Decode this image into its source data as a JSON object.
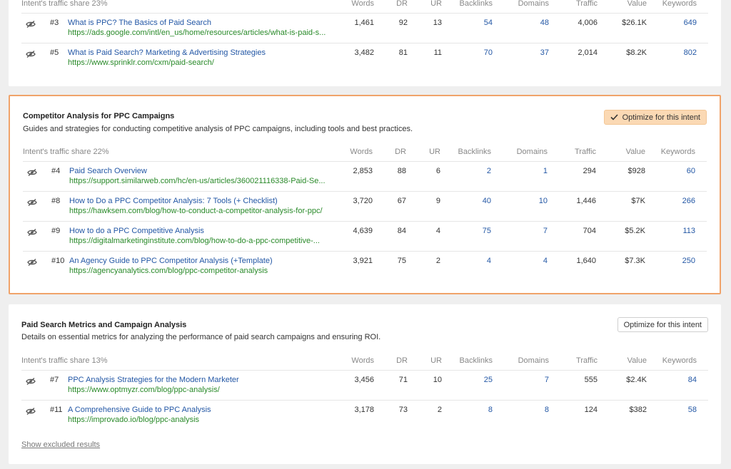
{
  "clusters": [
    {
      "traffic_share": "Intent's traffic share 23%",
      "rows": [
        {
          "rank": "#3",
          "title": "What is PPC? The Basics of Paid Search",
          "url": "https://ads.google.com/intl/en_us/home/resources/articles/what-is-paid-s...",
          "words": "1,461",
          "dr": "92",
          "ur": "13",
          "backlinks": "54",
          "domains": "48",
          "traffic": "4,006",
          "value": "$26.1K",
          "keywords": "649"
        },
        {
          "rank": "#5",
          "title": "What is Paid Search? Marketing & Advertising Strategies",
          "url": "https://www.sprinklr.com/cxm/paid-search/",
          "words": "3,482",
          "dr": "81",
          "ur": "11",
          "backlinks": "70",
          "domains": "37",
          "traffic": "2,014",
          "value": "$8.2K",
          "keywords": "802"
        }
      ]
    },
    {
      "title": "Competitor Analysis for PPC Campaigns",
      "description": "Guides and strategies for conducting competitive analysis of PPC campaigns, including tools and best practices.",
      "button_label": "Optimize for this intent",
      "traffic_share": "Intent's traffic share 22%",
      "rows": [
        {
          "rank": "#4",
          "title": "Paid Search Overview",
          "url": "https://support.similarweb.com/hc/en-us/articles/360021116338-Paid-Se...",
          "words": "2,853",
          "dr": "88",
          "ur": "6",
          "backlinks": "2",
          "domains": "1",
          "traffic": "294",
          "value": "$928",
          "keywords": "60"
        },
        {
          "rank": "#8",
          "title": "How to Do a PPC Competitor Analysis: 7 Tools (+ Checklist)",
          "url": "https://hawksem.com/blog/how-to-conduct-a-competitor-analysis-for-ppc/",
          "words": "3,720",
          "dr": "67",
          "ur": "9",
          "backlinks": "40",
          "domains": "10",
          "traffic": "1,446",
          "value": "$7K",
          "keywords": "266"
        },
        {
          "rank": "#9",
          "title": "How to do a PPC Competitive Analysis",
          "url": "https://digitalmarketinginstitute.com/blog/how-to-do-a-ppc-competitive-...",
          "words": "4,639",
          "dr": "84",
          "ur": "4",
          "backlinks": "75",
          "domains": "7",
          "traffic": "704",
          "value": "$5.2K",
          "keywords": "113"
        },
        {
          "rank": "#10",
          "title": "An Agency Guide to PPC Competitor Analysis (+Template)",
          "url": "https://agencyanalytics.com/blog/ppc-competitor-analysis",
          "words": "3,921",
          "dr": "75",
          "ur": "2",
          "backlinks": "4",
          "domains": "4",
          "traffic": "1,640",
          "value": "$7.3K",
          "keywords": "250"
        }
      ]
    },
    {
      "title": "Paid Search Metrics and Campaign Analysis",
      "description": "Details on essential metrics for analyzing the performance of paid search campaigns and ensuring ROI.",
      "button_label": "Optimize for this intent",
      "traffic_share": "Intent's traffic share 13%",
      "rows": [
        {
          "rank": "#7",
          "title": "PPC Analysis Strategies for the Modern Marketer",
          "url": "https://www.optmyzr.com/blog/ppc-analysis/",
          "words": "3,456",
          "dr": "71",
          "ur": "10",
          "backlinks": "25",
          "domains": "7",
          "traffic": "555",
          "value": "$2.4K",
          "keywords": "84"
        },
        {
          "rank": "#11",
          "title": "A Comprehensive Guide to PPC Analysis",
          "url": "https://improvado.io/blog/ppc-analysis",
          "words": "3,178",
          "dr": "73",
          "ur": "2",
          "backlinks": "8",
          "domains": "8",
          "traffic": "124",
          "value": "$382",
          "keywords": "58"
        }
      ],
      "excluded_link": "Show excluded results"
    }
  ],
  "columns": {
    "words": "Words",
    "dr": "DR",
    "ur": "UR",
    "backlinks": "Backlinks",
    "domains": "Domains",
    "traffic": "Traffic",
    "value": "Value",
    "keywords": "Keywords"
  },
  "icons": {
    "row_toggle": "eye-slash-icon",
    "selected": "check-icon"
  },
  "colors": {
    "active_border": "#f0a36a",
    "active_button": "#fbd9b4",
    "link": "#2357a5",
    "url": "#2a8a2a"
  }
}
